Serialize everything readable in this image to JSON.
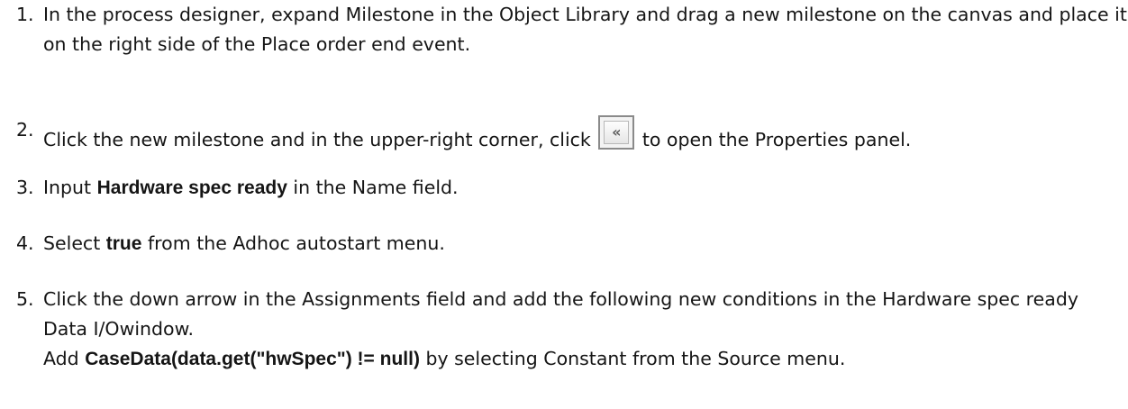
{
  "steps": [
    {
      "number": "1.",
      "t1": "In the process designer, expand ",
      "milestone": "Milestone",
      "t2": " in the ",
      "object_library": "Object Library",
      "t3": " and drag a new milestone on the canvas and place it on the right side of the ",
      "place_order": "Place order",
      "t4": " end event."
    },
    {
      "number": "2.",
      "t1": "Click the new milestone and in the upper-right corner, click ",
      "button_glyph": "«",
      "t2": " to open the ",
      "properties": "Properties",
      "t3": " panel."
    },
    {
      "number": "3.",
      "t1": "Input ",
      "value": "Hardware spec ready",
      "t2": " in the ",
      "name_field": "Name",
      "t3": " field."
    },
    {
      "number": "4.",
      "t1": "Select ",
      "value": "true",
      "t2": " from the ",
      "adhoc": "Adhoc autostart",
      "t3": " menu."
    },
    {
      "number": "5.",
      "t1": "Click the down arrow in the ",
      "assignments": "Assignments",
      "t2": " field and add the following new conditions in the ",
      "window_name": "Hardware spec ready Data I/O",
      "t3": "window.",
      "line2_t1": "Add ",
      "expression": "CaseData(data.get(\"hwSpec\") != null)",
      "line2_t2": " by selecting ",
      "constant": "Constant",
      "line2_t3": " from the ",
      "source": "Source",
      "line2_t4": " menu."
    }
  ]
}
